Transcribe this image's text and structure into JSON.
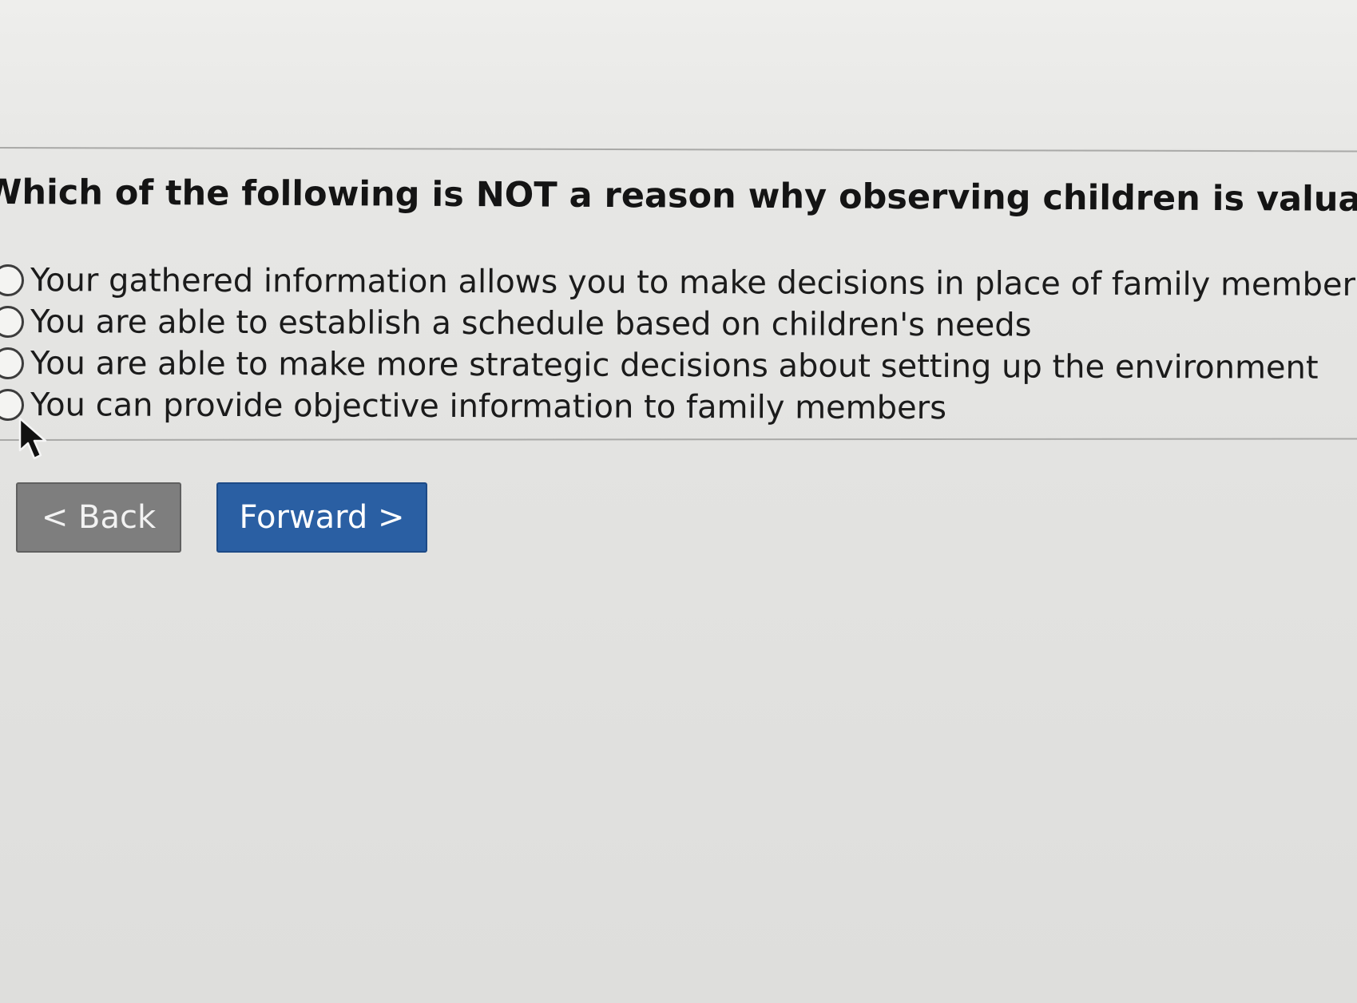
{
  "question": {
    "text": "Which of the following is NOT a reason why observing children is valuable"
  },
  "options": [
    {
      "label": "Your gathered information allows you to make decisions in place of family members",
      "selected": false
    },
    {
      "label": "You are able to establish a schedule based on children's needs",
      "selected": false
    },
    {
      "label": "You are able to make more strategic decisions about setting up the environment",
      "selected": false
    },
    {
      "label": "You can provide objective information to family members",
      "selected": false
    }
  ],
  "nav": {
    "back_label": "< Back",
    "forward_label": "Forward >"
  },
  "colors": {
    "forward_button": "#2a5fa3",
    "back_button": "#7e7e7e"
  },
  "icons": {
    "cursor": "mouse-pointer-icon"
  }
}
